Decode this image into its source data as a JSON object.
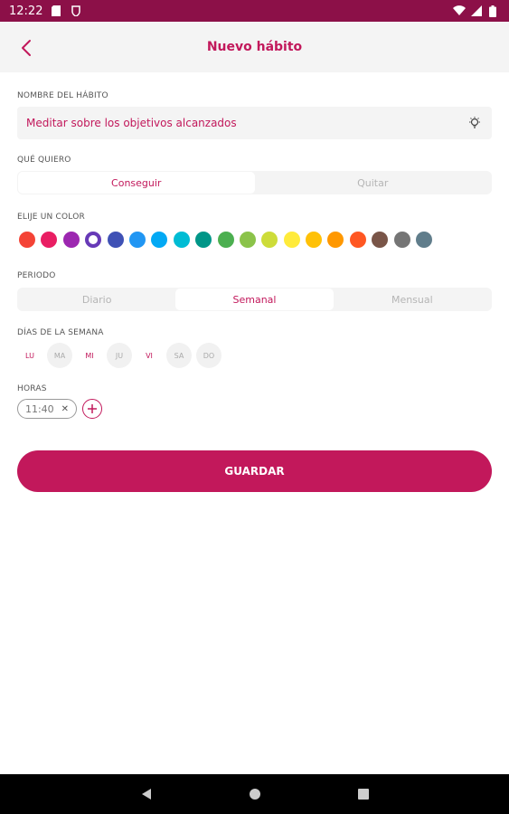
{
  "status_bar": {
    "time": "12:22"
  },
  "app_bar": {
    "title": "Nuevo hábito"
  },
  "form": {
    "name_label": "NOMBRE DEL HÁBITO",
    "name_value": "Meditar sobre los objetivos alcanzados",
    "want_label": "QUÉ QUIERO",
    "want_options": [
      "Conseguir",
      "Quitar"
    ],
    "want_selected": 0,
    "color_label": "ELIJE UN COLOR",
    "colors": [
      "#f44336",
      "#e91e63",
      "#9c27b0",
      "#673ab7",
      "#3f51b5",
      "#2196f3",
      "#03a9f4",
      "#00bcd4",
      "#009688",
      "#4caf50",
      "#8bc34a",
      "#cddc39",
      "#ffeb3b",
      "#ffc107",
      "#ff9800",
      "#ff5722",
      "#795548",
      "#757575",
      "#607d8b"
    ],
    "color_selected": 3,
    "period_label": "PERIODO",
    "period_options": [
      "Diario",
      "Semanal",
      "Mensual"
    ],
    "period_selected": 1,
    "days_label": "DÍAS DE LA SEMANA",
    "days": [
      "LU",
      "MA",
      "MI",
      "JU",
      "VI",
      "SA",
      "DO"
    ],
    "days_active": [
      true,
      false,
      true,
      false,
      true,
      false,
      false
    ],
    "hours_label": "HORAS",
    "hours": [
      "11:40"
    ],
    "save_label": "GUARDAR"
  },
  "theme": {
    "accent": "#c2185b",
    "status_bar": "#8c1048"
  }
}
